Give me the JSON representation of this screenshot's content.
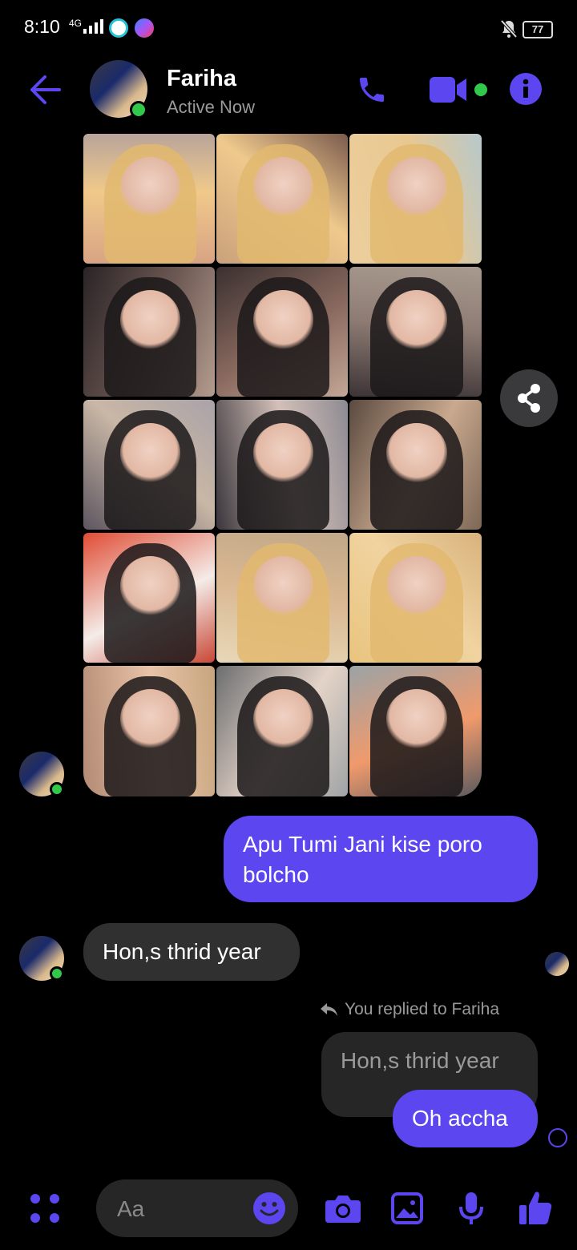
{
  "status_bar": {
    "time": "8:10",
    "network": "4G",
    "battery": "77"
  },
  "header": {
    "contact_name": "Fariha",
    "status": "Active Now"
  },
  "messages": {
    "sent_1": "Apu Tumi Jani kise poro bolcho",
    "received_1": "Hon,s thrid year",
    "reply_note": "You replied to Fariha",
    "quoted_text": "Hon,s thrid year",
    "sent_2": "Oh accha"
  },
  "composer": {
    "placeholder": "Aa"
  },
  "colors": {
    "accent": "#5b46f0",
    "online": "#31c94b",
    "received_bubble": "#303030",
    "background": "#000000"
  },
  "icons": [
    "back-arrow-icon",
    "phone-icon",
    "video-camera-icon",
    "info-icon",
    "share-icon",
    "apps-icon",
    "emoji-icon",
    "camera-icon",
    "gallery-icon",
    "microphone-icon",
    "thumbs-up-icon",
    "mute-bell-icon"
  ]
}
